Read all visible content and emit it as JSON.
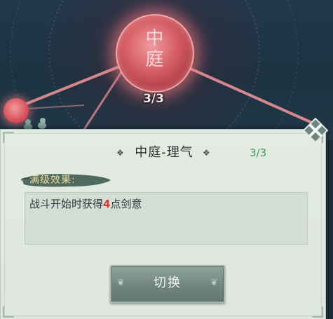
{
  "node": {
    "glyph_top": "中",
    "glyph_bottom": "庭",
    "progress": "3/3"
  },
  "panel": {
    "title": "中庭-理气",
    "level": "3/3",
    "title_deco_left": "❖",
    "title_deco_right": "❖",
    "effect_label": "满级效果:",
    "effect_prefix": "战斗开始时获得",
    "effect_value": "4",
    "effect_suffix": "点剑意",
    "switch_label": "切换",
    "close_icon": "close-x-icon"
  },
  "colors": {
    "node_red": "#d35a62",
    "level_green": "#3c9a63",
    "highlight_red": "#d93a2b",
    "label_gold": "#f1dca0"
  }
}
